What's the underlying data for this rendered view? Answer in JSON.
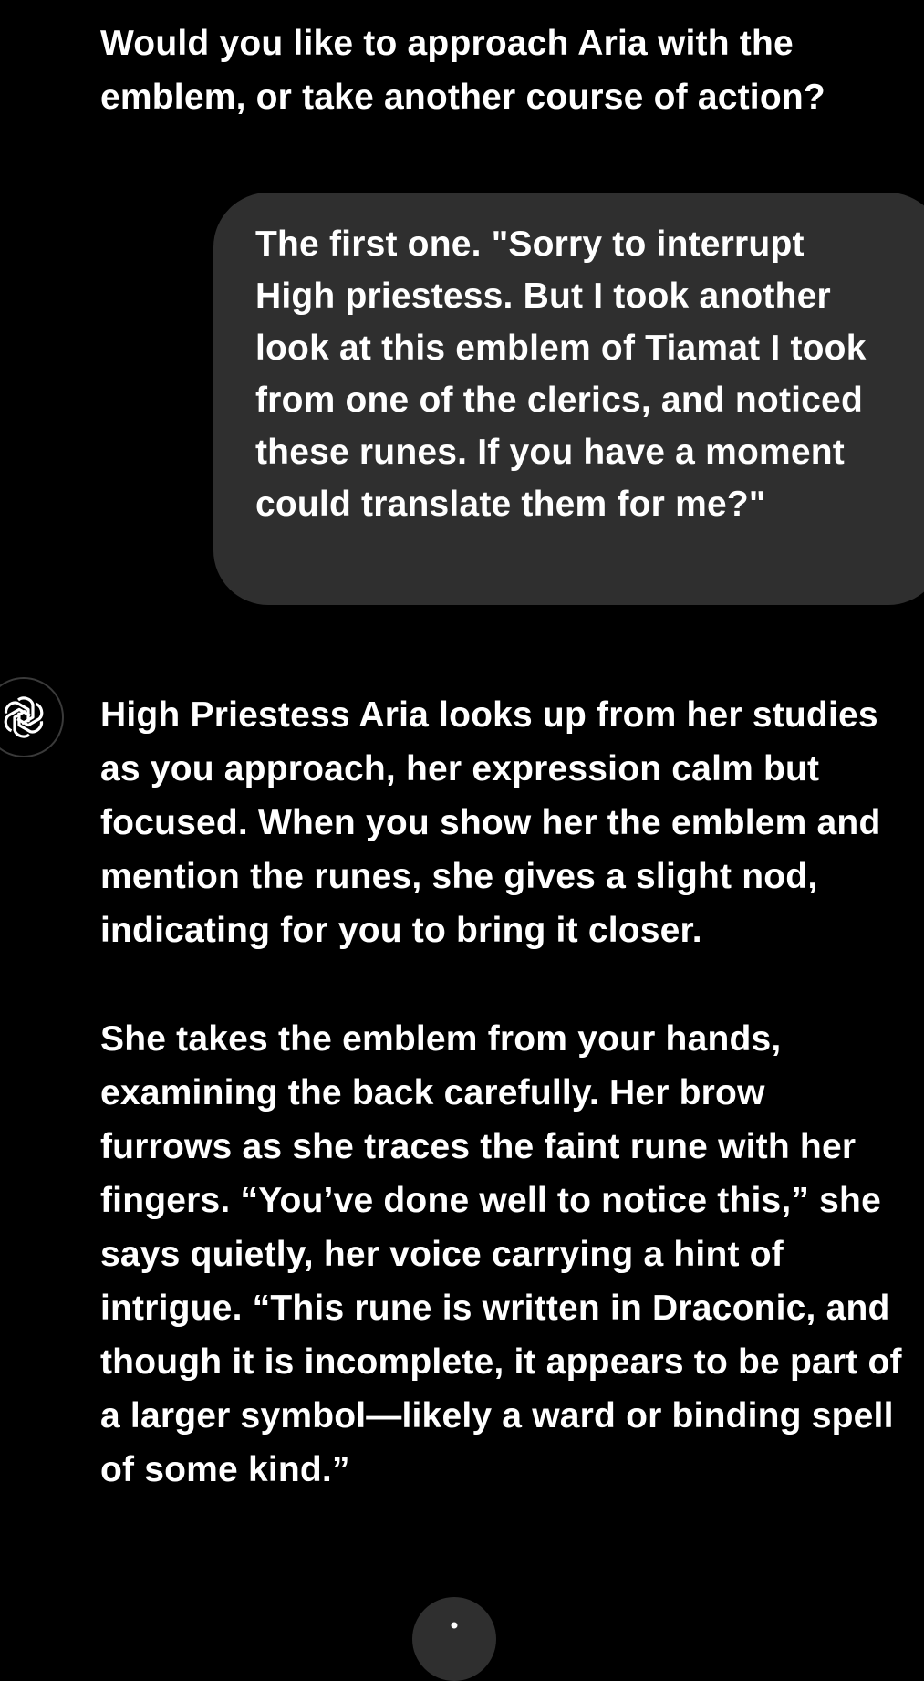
{
  "messages": [
    {
      "role": "assistant",
      "paragraphs": [
        "Would you like to approach Aria with the emblem, or take another course of action?"
      ]
    },
    {
      "role": "user",
      "text": "The first one. \"Sorry to interrupt High priestess. But I took another look at this emblem of Tiamat I took from one of the clerics, and noticed these runes. If you have a moment could translate them for me?\""
    },
    {
      "role": "assistant",
      "paragraphs": [
        "High Priestess Aria looks up from her studies as you approach, her expression calm but focused. When you show her the emblem and mention the runes, she gives a slight nod, indicating for you to bring it closer.",
        "She takes the emblem from your hands, examining the back carefully. Her brow furrows as she traces the faint rune with her fingers. “You’ve done well to notice this,” she says quietly, her voice carrying a hint of intrigue. “This rune is written in Draconic, and though it is incomplete, it appears to be part of a larger symbol—likely a ward or binding spell of some kind.”"
      ]
    }
  ],
  "icons": {
    "assistant_avatar": "openai-logo-icon",
    "scroll_button": "arrow-down-icon"
  },
  "colors": {
    "background": "#000000",
    "user_bubble": "#2f2f2f",
    "text": "#ffffff"
  }
}
